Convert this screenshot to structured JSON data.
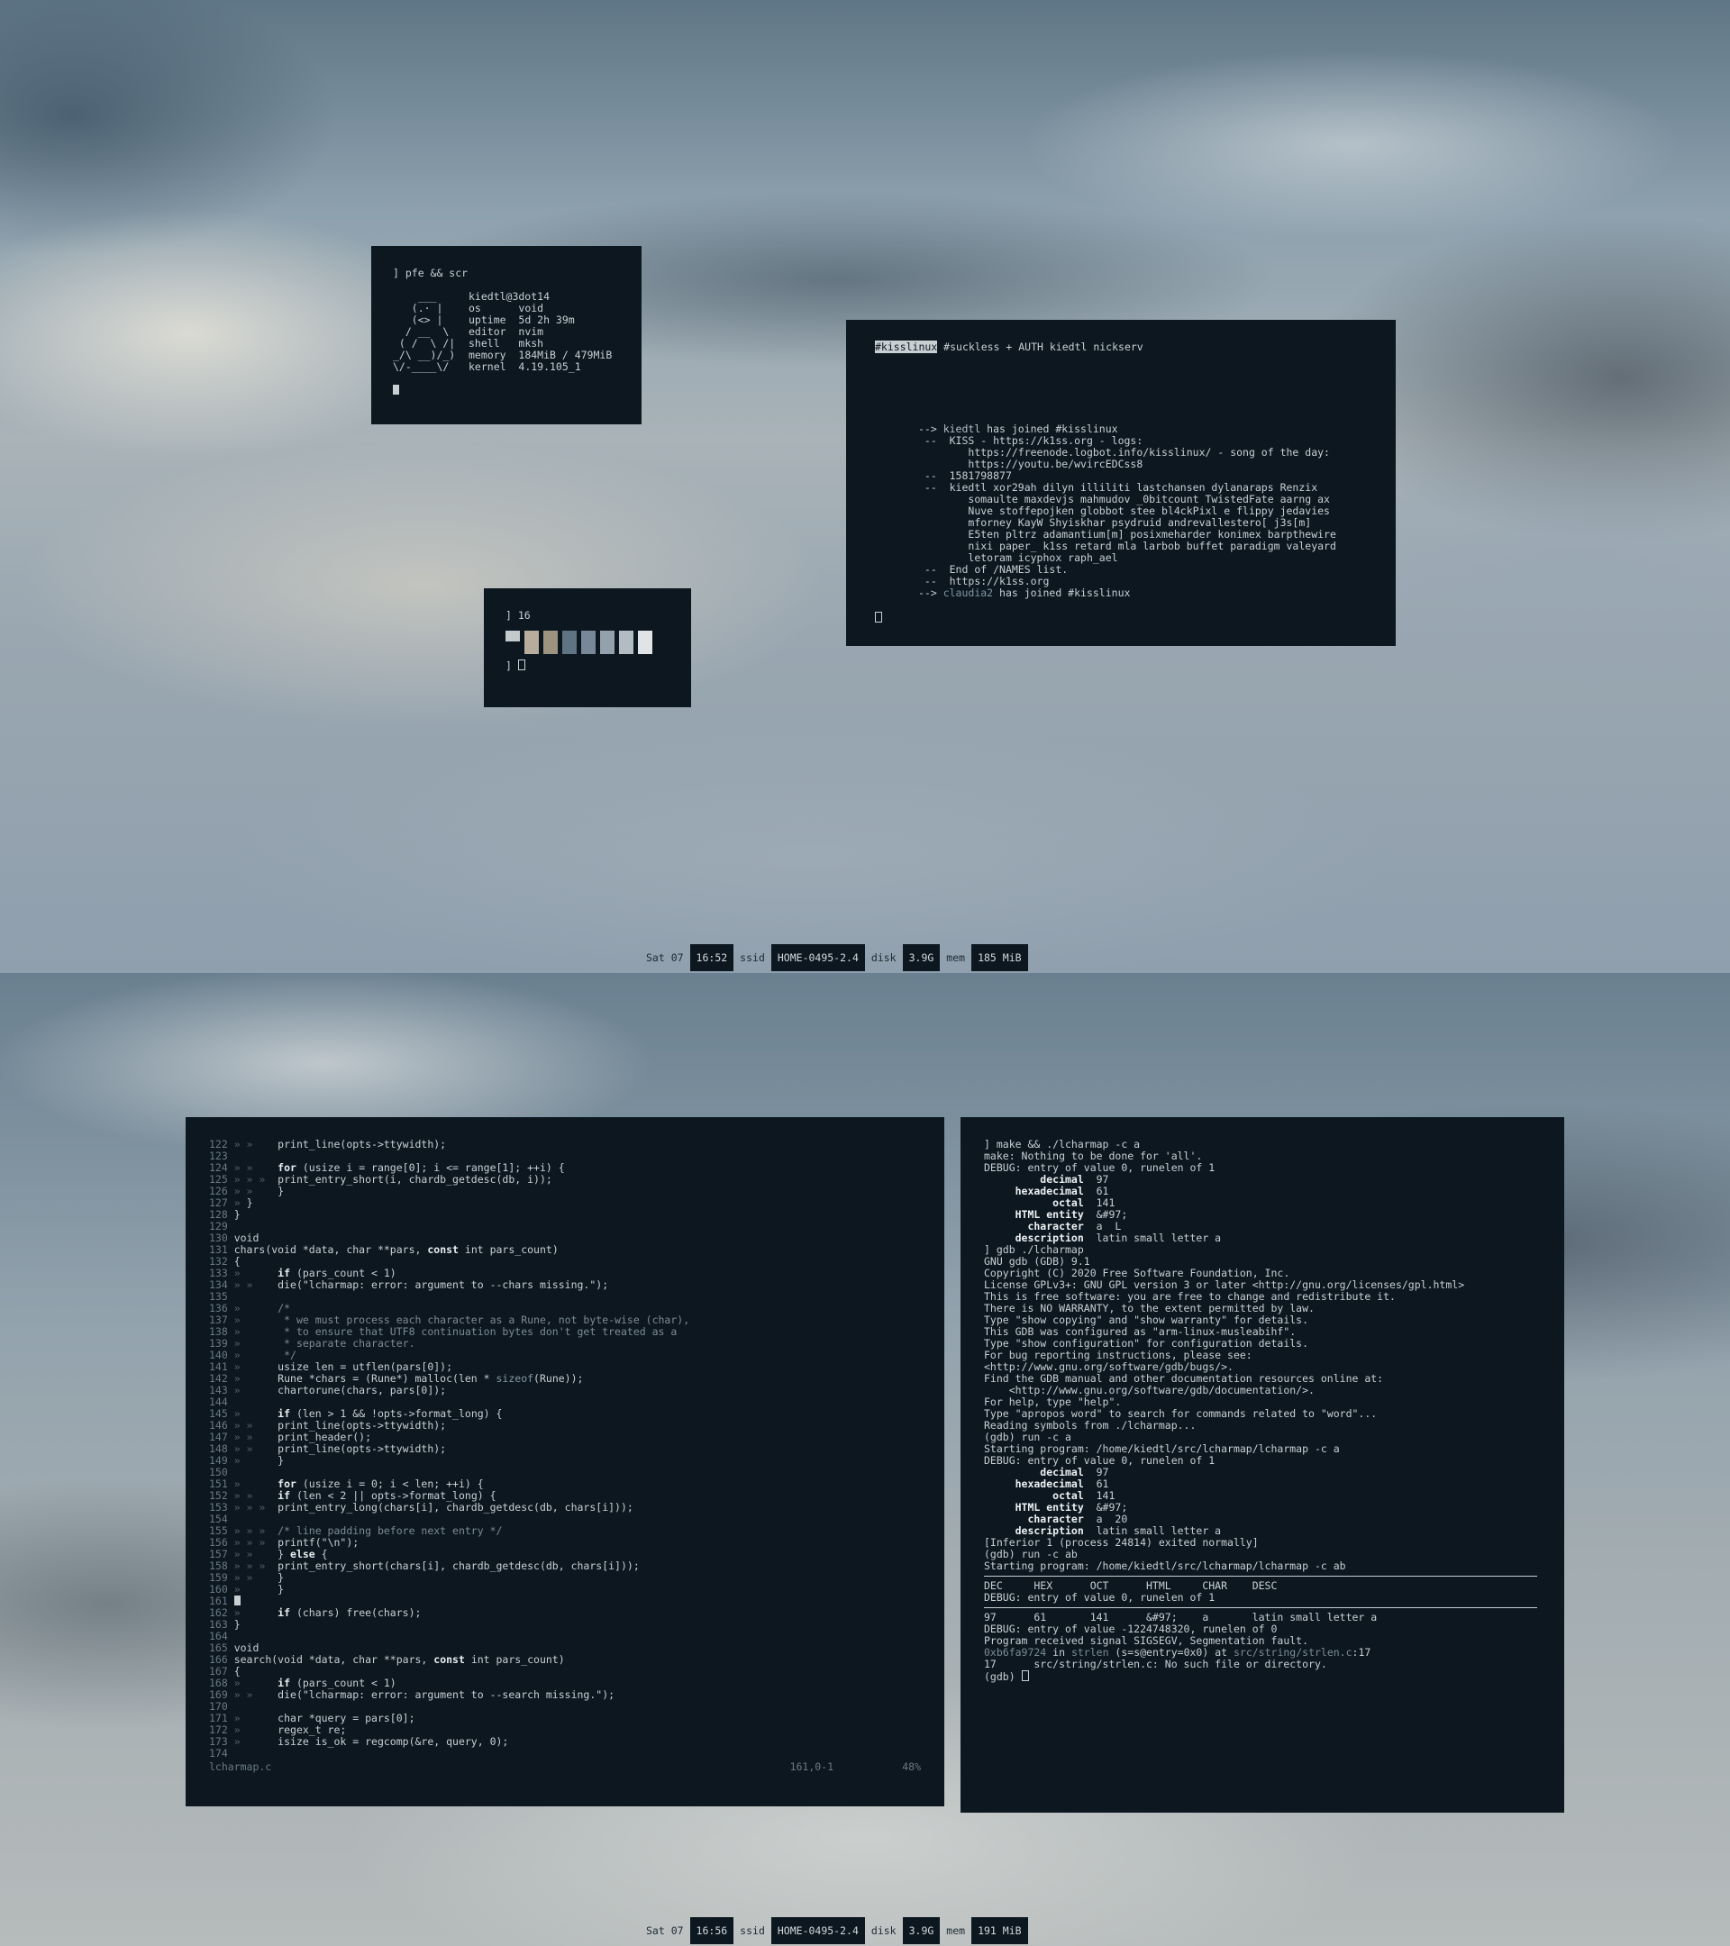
{
  "top": {
    "fetch": {
      "prompt": "] pfe && scr",
      "ascii": [
        "    ___",
        "   (.· |",
        "   (<> |",
        "  / __  \\",
        " ( /  \\ /|",
        "_/\\ __)/_)",
        "\\/-____\\/"
      ],
      "user": "kiedtl@3dot14",
      "rows": [
        {
          "key": "os",
          "val": "void"
        },
        {
          "key": "uptime",
          "val": "5d 2h 39m"
        },
        {
          "key": "editor",
          "val": "nvim"
        },
        {
          "key": "shell",
          "val": "mksh"
        },
        {
          "key": "memory",
          "val": "184MiB / 479MiB"
        },
        {
          "key": "kernel",
          "val": "4.19.105_1"
        }
      ]
    },
    "palette": {
      "prompt": "] 16",
      "colors": [
        "#c4c9cb",
        "#b8ad9c",
        "#9d9480",
        "#5f7382",
        "#788898",
        "#93a1ad",
        "#b3bcc2",
        "#e1e4e6"
      ],
      "prompt2": "] "
    },
    "irc": {
      "active_channel": "#kisslinux",
      "header_rest": " #suckless + AUTH kiedtl nickserv",
      "lines": [
        {
          "prefix": "-->",
          "nick": "kiedtl",
          "text": " has joined #kisslinux"
        },
        {
          "prefix": " --",
          "nick": "",
          "text": " KISS - https://k1ss.org - logs:"
        },
        {
          "prefix": "",
          "nick": "",
          "text": "    https://freenode.logbot.info/kisslinux/ - song of the day:"
        },
        {
          "prefix": "",
          "nick": "",
          "text": "    https://youtu.be/wvircEDCss8"
        },
        {
          "prefix": " --",
          "nick": "",
          "text": " 1581798877"
        },
        {
          "prefix": " --",
          "nick": "",
          "text": " kiedtl xor29ah dilyn illiliti lastchansen dylanaraps Renzix"
        },
        {
          "prefix": "",
          "nick": "",
          "text": "    somaulte maxdevjs mahmudov _0bitcount TwistedFate aarng ax"
        },
        {
          "prefix": "",
          "nick": "",
          "text": "    Nuve stoffepojken globbot stee bl4ckPixl e flippy jedavies"
        },
        {
          "prefix": "",
          "nick": "",
          "text": "    mforney KayW Shyiskhar psydruid andrevallestero[ j3s[m]"
        },
        {
          "prefix": "",
          "nick": "",
          "text": "    E5ten pltrz adamantium[m] posixmeharder konimex barpthewire"
        },
        {
          "prefix": "",
          "nick": "",
          "text": "    nixi paper_ k1ss retard mla larbob buffet paradigm valeyard"
        },
        {
          "prefix": "",
          "nick": "",
          "text": "    letoram icyphox raph_ael"
        },
        {
          "prefix": " --",
          "nick": "",
          "text": " End of /NAMES list."
        },
        {
          "prefix": " --",
          "nick": "",
          "text": " https://k1ss.org"
        },
        {
          "prefix": "-->",
          "nick2": "claudia2",
          "text": " has joined #kisslinux"
        }
      ]
    },
    "status": {
      "day": "Sat 07",
      "time": "16:52",
      "ssid_label": "ssid",
      "ssid": "HOME-0495-2.4",
      "disk_label": "disk",
      "disk": "3.9G",
      "mem_label": "mem",
      "mem": "185 MiB"
    }
  },
  "bottom": {
    "editor": {
      "lines": [
        {
          "n": "122",
          "i": "» »    ",
          "c": [
            {
              "t": "print_line(opts->ttywidth);"
            }
          ]
        },
        {
          "n": "123",
          "i": "",
          "c": []
        },
        {
          "n": "124",
          "i": "» »    ",
          "c": [
            {
              "t": "for",
              "k": "kw"
            },
            {
              "t": " (usize i = range[0]; i <= range[1]; ++i) {"
            }
          ]
        },
        {
          "n": "125",
          "i": "» » »  ",
          "c": [
            {
              "t": "print_entry_short(i, chardb_getdesc(db, i));"
            }
          ]
        },
        {
          "n": "126",
          "i": "» »    ",
          "c": [
            {
              "t": "}"
            }
          ]
        },
        {
          "n": "127",
          "i": "» ",
          "c": [
            {
              "t": "}"
            }
          ]
        },
        {
          "n": "128",
          "i": "",
          "c": [
            {
              "t": "}"
            }
          ]
        },
        {
          "n": "129",
          "i": "",
          "c": []
        },
        {
          "n": "130",
          "i": "",
          "c": [
            {
              "t": "void"
            }
          ]
        },
        {
          "n": "131",
          "i": "",
          "c": [
            {
              "t": "chars(void *data, char **pars, "
            },
            {
              "t": "const",
              "k": "kw"
            },
            {
              "t": " int pars_count)"
            }
          ]
        },
        {
          "n": "132",
          "i": "",
          "c": [
            {
              "t": "{"
            }
          ]
        },
        {
          "n": "133",
          "i": "»      ",
          "c": [
            {
              "t": "if",
              "k": "kw"
            },
            {
              "t": " (pars_count < 1)"
            }
          ]
        },
        {
          "n": "134",
          "i": "» »    ",
          "c": [
            {
              "t": "die(\"lcharmap: error: argument to --chars missing.\");"
            }
          ]
        },
        {
          "n": "135",
          "i": "",
          "c": []
        },
        {
          "n": "136",
          "i": "»      ",
          "c": [
            {
              "t": "/*",
              "k": "cm"
            }
          ]
        },
        {
          "n": "137",
          "i": "»      ",
          "c": [
            {
              "t": " * we must process each character as a Rune, not byte-wise (char),",
              "k": "cm"
            }
          ]
        },
        {
          "n": "138",
          "i": "»      ",
          "c": [
            {
              "t": " * to ensure that UTF8 continuation bytes don't get treated as a",
              "k": "cm"
            }
          ]
        },
        {
          "n": "139",
          "i": "»      ",
          "c": [
            {
              "t": " * separate character.",
              "k": "cm"
            }
          ]
        },
        {
          "n": "140",
          "i": "»      ",
          "c": [
            {
              "t": " */",
              "k": "cm"
            }
          ]
        },
        {
          "n": "141",
          "i": "»      ",
          "c": [
            {
              "t": "usize len = utflen(pars[0]);"
            }
          ]
        },
        {
          "n": "142",
          "i": "»      ",
          "c": [
            {
              "t": "Rune *chars = (Rune*) malloc(len * "
            },
            {
              "t": "sizeof",
              "k": "fnc"
            },
            {
              "t": "(Rune));"
            }
          ]
        },
        {
          "n": "143",
          "i": "»      ",
          "c": [
            {
              "t": "chartorune(chars, pars[0]);"
            }
          ]
        },
        {
          "n": "144",
          "i": "",
          "c": []
        },
        {
          "n": "145",
          "i": "»      ",
          "c": [
            {
              "t": "if",
              "k": "kw"
            },
            {
              "t": " (len > 1 && !opts->format_long) {"
            }
          ]
        },
        {
          "n": "146",
          "i": "» »    ",
          "c": [
            {
              "t": "print_line(opts->ttywidth);"
            }
          ]
        },
        {
          "n": "147",
          "i": "» »    ",
          "c": [
            {
              "t": "print_header();"
            }
          ]
        },
        {
          "n": "148",
          "i": "» »    ",
          "c": [
            {
              "t": "print_line(opts->ttywidth);"
            }
          ]
        },
        {
          "n": "149",
          "i": "»      ",
          "c": [
            {
              "t": "}"
            }
          ]
        },
        {
          "n": "150",
          "i": "",
          "c": []
        },
        {
          "n": "151",
          "i": "»      ",
          "c": [
            {
              "t": "for",
              "k": "kw"
            },
            {
              "t": " (usize i = 0; i < len; ++i) {"
            }
          ]
        },
        {
          "n": "152",
          "i": "» »    ",
          "c": [
            {
              "t": "if",
              "k": "kw"
            },
            {
              "t": " (len < 2 || opts->format_long) {"
            }
          ]
        },
        {
          "n": "153",
          "i": "» » »  ",
          "c": [
            {
              "t": "print_entry_long(chars[i], chardb_getdesc(db, chars[i]));"
            }
          ]
        },
        {
          "n": "154",
          "i": "",
          "c": []
        },
        {
          "n": "155",
          "i": "» » »  ",
          "c": [
            {
              "t": "/* line padding before next entry */",
              "k": "cm"
            }
          ]
        },
        {
          "n": "156",
          "i": "» » »  ",
          "c": [
            {
              "t": "printf(\"\\n\");"
            }
          ]
        },
        {
          "n": "157",
          "i": "» »    ",
          "c": [
            {
              "t": "} "
            },
            {
              "t": "else",
              "k": "kw"
            },
            {
              "t": " {"
            }
          ]
        },
        {
          "n": "158",
          "i": "» » »  ",
          "c": [
            {
              "t": "print_entry_short(chars[i], chardb_getdesc(db, chars[i]));"
            }
          ]
        },
        {
          "n": "159",
          "i": "» »    ",
          "c": [
            {
              "t": "}"
            }
          ]
        },
        {
          "n": "160",
          "i": "»      ",
          "c": [
            {
              "t": "}"
            }
          ]
        },
        {
          "n": "161",
          "i": "",
          "c": [],
          "cursor": true
        },
        {
          "n": "162",
          "i": "»      ",
          "c": [
            {
              "t": "if",
              "k": "kw"
            },
            {
              "t": " (chars) free(chars);"
            }
          ]
        },
        {
          "n": "163",
          "i": "",
          "c": [
            {
              "t": "}"
            }
          ]
        },
        {
          "n": "164",
          "i": "",
          "c": []
        },
        {
          "n": "165",
          "i": "",
          "c": [
            {
              "t": "void"
            }
          ]
        },
        {
          "n": "166",
          "i": "",
          "c": [
            {
              "t": "search(void *data, char **pars, "
            },
            {
              "t": "const",
              "k": "kw"
            },
            {
              "t": " int pars_count)"
            }
          ]
        },
        {
          "n": "167",
          "i": "",
          "c": [
            {
              "t": "{"
            }
          ]
        },
        {
          "n": "168",
          "i": "»      ",
          "c": [
            {
              "t": "if",
              "k": "kw"
            },
            {
              "t": " (pars_count < 1)"
            }
          ]
        },
        {
          "n": "169",
          "i": "» »    ",
          "c": [
            {
              "t": "die(\"lcharmap: error: argument to --search missing.\");"
            }
          ]
        },
        {
          "n": "170",
          "i": "",
          "c": []
        },
        {
          "n": "171",
          "i": "»      ",
          "c": [
            {
              "t": "char *query = pars[0];"
            }
          ]
        },
        {
          "n": "172",
          "i": "»      ",
          "c": [
            {
              "t": "regex_t re;"
            }
          ]
        },
        {
          "n": "173",
          "i": "»      ",
          "c": [
            {
              "t": "isize is_ok = regcomp(&re, query, 0);"
            }
          ]
        },
        {
          "n": "174",
          "i": "",
          "c": []
        }
      ],
      "filename": "lcharmap.c",
      "position": "161,0-1",
      "percent": "48%"
    },
    "gdb": {
      "lines": [
        "] make && ./lcharmap -c a",
        "make: Nothing to be done for 'all'.",
        "DEBUG: entry of value 0, runelen of 1",
        "@@         decimal  97",
        "@@     hexadecimal  61",
        "@@           octal  141",
        "@@     HTML entity  &#97;",
        "@@       character  a  L",
        "@@     description  latin small letter a",
        "",
        "] gdb ./lcharmap",
        "GNU gdb (GDB) 9.1",
        "Copyright (C) 2020 Free Software Foundation, Inc.",
        "License GPLv3+: GNU GPL version 3 or later <http://gnu.org/licenses/gpl.html>",
        "This is free software: you are free to change and redistribute it.",
        "There is NO WARRANTY, to the extent permitted by law.",
        "Type \"show copying\" and \"show warranty\" for details.",
        "This GDB was configured as \"arm-linux-musleabihf\".",
        "Type \"show configuration\" for configuration details.",
        "For bug reporting instructions, please see:",
        "<http://www.gnu.org/software/gdb/bugs/>.",
        "Find the GDB manual and other documentation resources online at:",
        "    <http://www.gnu.org/software/gdb/documentation/>.",
        "",
        "For help, type \"help\".",
        "Type \"apropos word\" to search for commands related to \"word\"...",
        "Reading symbols from ./lcharmap...",
        "(gdb) run -c a",
        "Starting program: /home/kiedtl/src/lcharmap/lcharmap -c a",
        "DEBUG: entry of value 0, runelen of 1",
        "@@         decimal  97",
        "@@     hexadecimal  61",
        "@@           octal  141",
        "@@     HTML entity  &#97;",
        "@@       character  a  20",
        "@@     description  latin small letter a",
        "",
        "[Inferior 1 (process 24814) exited normally]",
        "(gdb) run -c ab",
        "Starting program: /home/kiedtl/src/lcharmap/lcharmap -c ab",
        "--HR--",
        "DEC     HEX      OCT      HTML     CHAR    DESC",
        "DEBUG: entry of value 0, runelen of 1",
        "--HR--",
        "97      61       141      &#97;    a       latin small letter a",
        "DEBUG: entry of value -1224748320, runelen of 0",
        "",
        "Program received signal SIGSEGV, Segmentation fault.",
        "0xb6fa9724 in strlen (s=s@entry=0x0) at src/string/strlen.c:17",
        "17      src/string/strlen.c: No such file or directory.",
        "(gdb) "
      ]
    },
    "status": {
      "day": "Sat 07",
      "time": "16:56",
      "ssid_label": "ssid",
      "ssid": "HOME-0495-2.4",
      "disk_label": "disk",
      "disk": "3.9G",
      "mem_label": "mem",
      "mem": "191 MiB"
    }
  }
}
